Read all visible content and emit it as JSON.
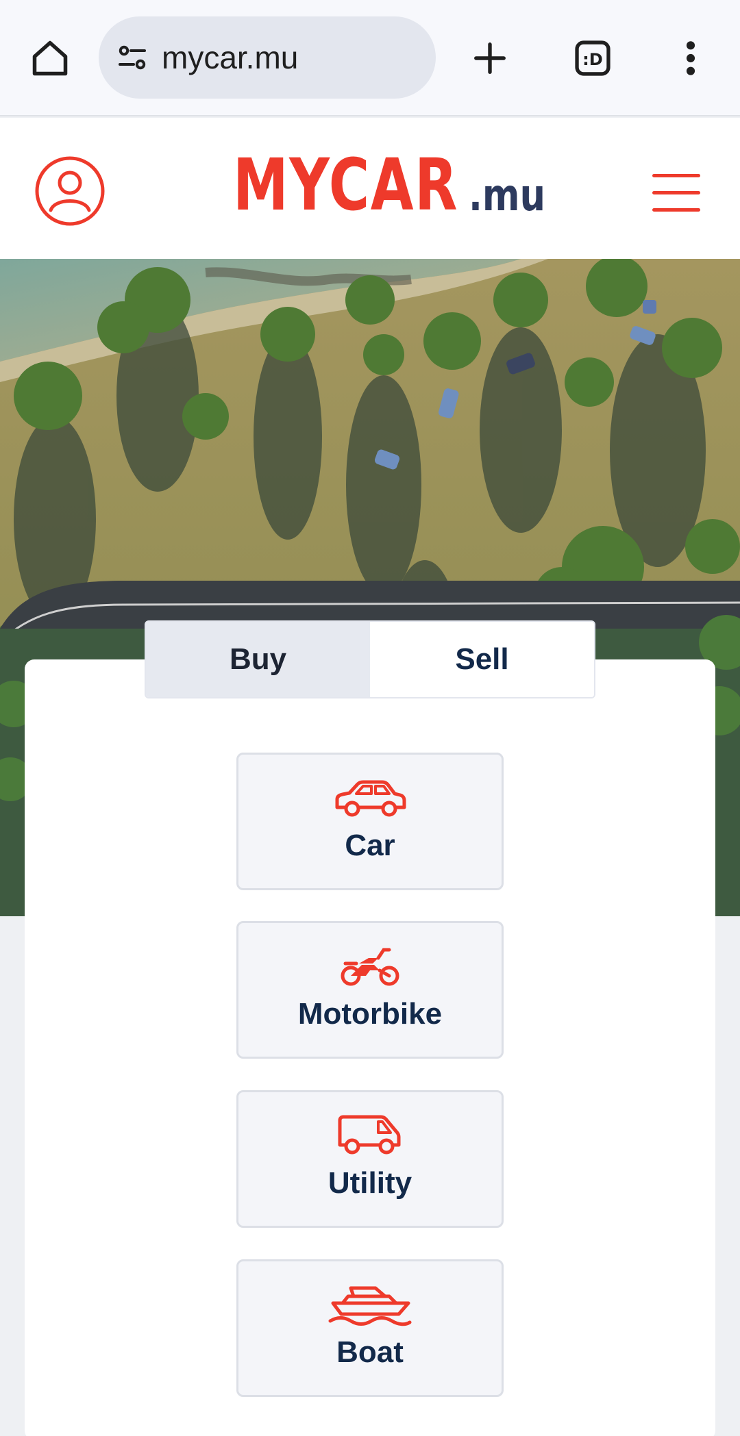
{
  "browser": {
    "url": "mycar.mu",
    "icons": [
      "home-icon",
      "tune-icon",
      "plus-icon",
      "tab-switcher-icon",
      "more-vert-icon"
    ],
    "tab_switcher_text": ":D"
  },
  "header": {
    "logo_main": "MYCAR",
    "logo_tld": ".mu",
    "icons": [
      "user-icon",
      "hamburger-menu-icon"
    ]
  },
  "colors": {
    "brand_red": "#ee3a2b",
    "navy": "#12294a",
    "logo_tld": "#2d3a5e",
    "page_bg": "#eef0f3",
    "tile_bg": "#f4f5f9",
    "active_tab_bg": "#e6e9f0"
  },
  "mode_toggle": {
    "options": [
      {
        "label": "Buy",
        "selected": true
      },
      {
        "label": "Sell",
        "selected": false
      }
    ]
  },
  "vehicle_types": [
    {
      "label": "Car",
      "icon": "car-icon"
    },
    {
      "label": "Motorbike",
      "icon": "motorbike-icon"
    },
    {
      "label": "Utility",
      "icon": "van-icon"
    },
    {
      "label": "Boat",
      "icon": "boat-icon"
    }
  ]
}
